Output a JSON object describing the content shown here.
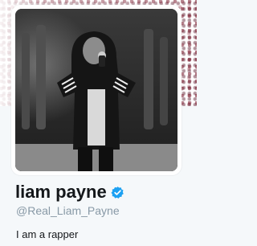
{
  "profile": {
    "name": "liam payne",
    "handle": "@Real_Liam_Payne",
    "bio": "I am a rapper",
    "verified": true,
    "verified_icon": "verified-badge-icon"
  },
  "colors": {
    "name": "#14171a",
    "handle": "#8899a6",
    "verified_badge": "#1da1f2",
    "background": "#f5f8fa"
  }
}
